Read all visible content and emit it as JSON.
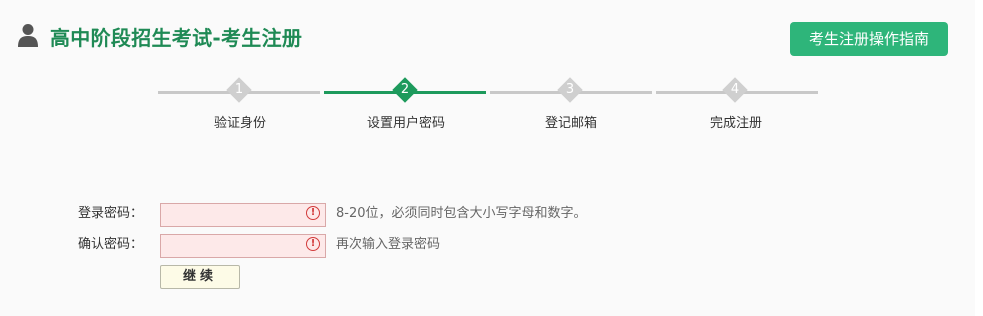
{
  "header": {
    "user_icon": "user-icon",
    "title": "高中阶段招生考试-考生注册",
    "guide_button": "考生注册操作指南"
  },
  "steps": [
    {
      "number": "1",
      "label": "验证身份",
      "active": false
    },
    {
      "number": "2",
      "label": "设置用户密码",
      "active": true
    },
    {
      "number": "3",
      "label": "登记邮箱",
      "active": false
    },
    {
      "number": "4",
      "label": "完成注册",
      "active": false
    }
  ],
  "form": {
    "password": {
      "label": "登录密码：",
      "value": "",
      "hint": "8-20位，必须同时包含大小写字母和数字。",
      "warning_icon": "warning-icon"
    },
    "confirm": {
      "label": "确认密码：",
      "value": "",
      "hint": "再次输入登录密码",
      "warning_icon": "warning-icon"
    },
    "continue_button": "继续"
  },
  "colors": {
    "brand_green": "#1f8a55",
    "button_green": "#2eb57a",
    "active_step": "#1d9a5c",
    "inactive_step": "#c8c8c8",
    "input_error_bg": "#fde9e9",
    "warning_red": "#d23b3b"
  }
}
